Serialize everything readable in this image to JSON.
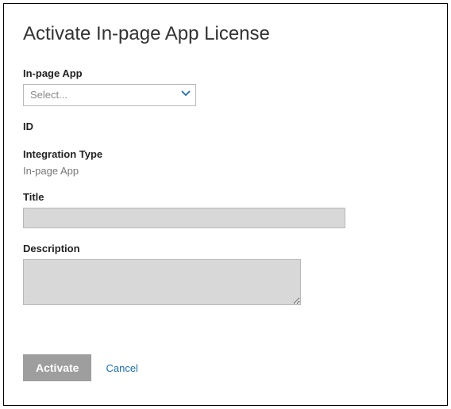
{
  "header": {
    "title": "Activate In-page App License"
  },
  "fields": {
    "app": {
      "label": "In-page App",
      "placeholder": "Select..."
    },
    "id": {
      "label": "ID",
      "value": ""
    },
    "integration_type": {
      "label": "Integration Type",
      "value": "In-page App"
    },
    "title": {
      "label": "Title",
      "value": ""
    },
    "description": {
      "label": "Description",
      "value": ""
    }
  },
  "actions": {
    "activate_label": "Activate",
    "cancel_label": "Cancel"
  },
  "colors": {
    "link": "#1a6fb5",
    "disabled_bg": "#d8d8d8",
    "button_bg": "#9e9e9e"
  }
}
